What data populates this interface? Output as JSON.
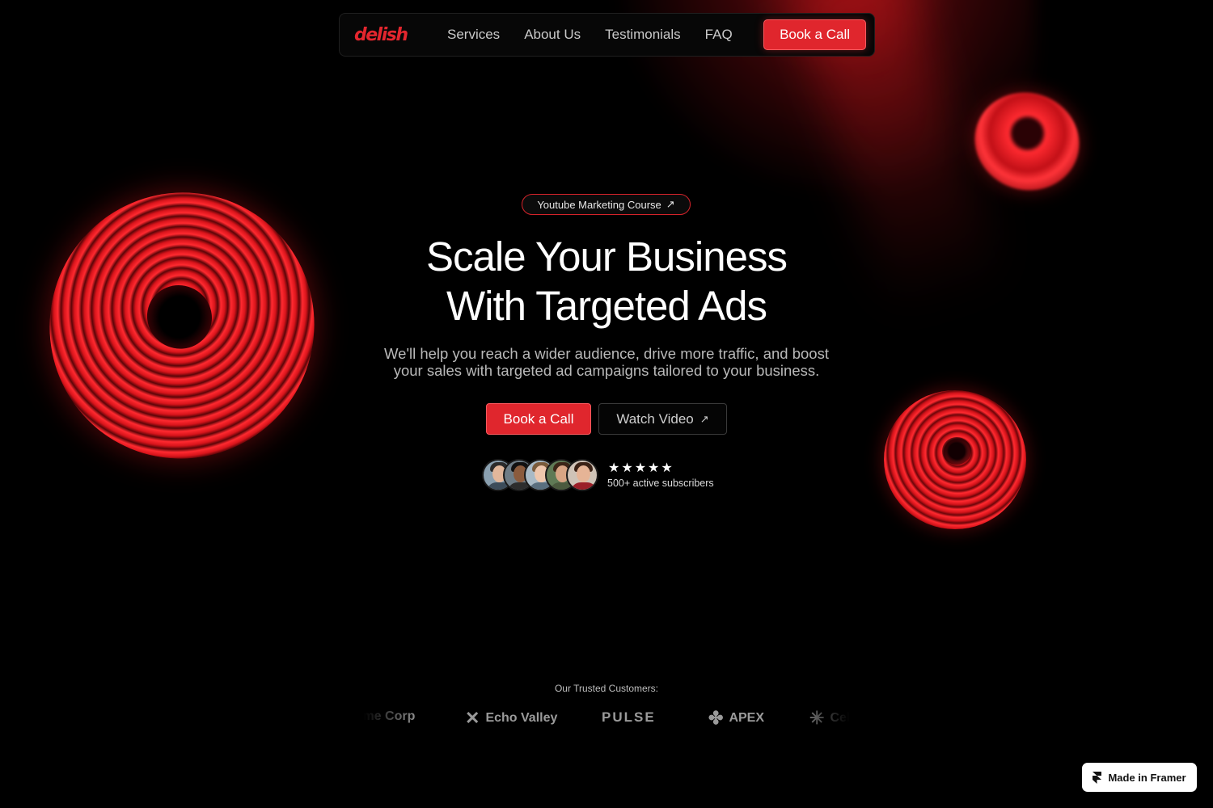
{
  "nav": {
    "logo": "delish",
    "links": [
      "Services",
      "About Us",
      "Testimonials",
      "FAQ"
    ],
    "cta": "Book a Call"
  },
  "hero": {
    "pill": "Youtube Marketing Course",
    "pill_icon": "arrow-up-right-icon",
    "title_line1": "Scale Your Business",
    "title_line2": "With Targeted Ads",
    "subtitle_line1": "We'll help you reach a wider audience, drive more traffic, and boost",
    "subtitle_line2": "your sales with targeted ad campaigns tailored to your business.",
    "primary_button": "Book a Call",
    "secondary_button": "Watch Video",
    "secondary_icon": "arrow-up-right-icon"
  },
  "social_proof": {
    "rating_stars": 5,
    "subscribers": "500+ active subscribers"
  },
  "customers": {
    "label": "Our Trusted Customers:",
    "logos": [
      "Acme Corp",
      "Echo Valley",
      "PULSE",
      "APEX",
      "Celestial"
    ]
  },
  "badge": {
    "label": "Made in Framer"
  },
  "colors": {
    "accent": "#e0262d",
    "background": "#000000",
    "text": "#ffffff"
  }
}
